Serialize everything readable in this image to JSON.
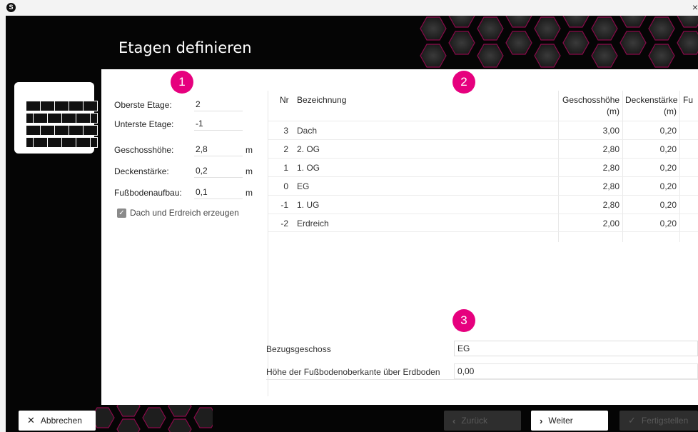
{
  "window": {
    "app_icon": "S",
    "close_glyph": "×"
  },
  "header": {
    "title": "Etagen definieren"
  },
  "markers": [
    "1",
    "2",
    "3"
  ],
  "form": {
    "oberste_label": "Oberste Etage:",
    "oberste_value": "2",
    "unterste_label": "Unterste Etage:",
    "unterste_value": "-1",
    "geschoss_label": "Geschosshöhe:",
    "geschoss_value": "2,8",
    "geschoss_unit": "m",
    "decken_label": "Deckenstärke:",
    "decken_value": "0,2",
    "decken_unit": "m",
    "fuss_label": "Fußbodenaufbau:",
    "fuss_value": "0,1",
    "fuss_unit": "m",
    "checkbox_label": "Dach und Erdreich erzeugen",
    "checkbox_checked": true
  },
  "table": {
    "headers": {
      "nr": "Nr",
      "bez": "Bezeichnung",
      "geschoss": "Geschosshöhe",
      "geschoss_unit": "(m)",
      "decken": "Deckenstärke",
      "decken_unit": "(m)",
      "fu": "Fu"
    },
    "rows": [
      {
        "nr": "3",
        "bez": "Dach",
        "geschoss": "3,00",
        "decken": "0,20"
      },
      {
        "nr": "2",
        "bez": "2. OG",
        "geschoss": "2,80",
        "decken": "0,20"
      },
      {
        "nr": "1",
        "bez": "1. OG",
        "geschoss": "2,80",
        "decken": "0,20"
      },
      {
        "nr": "0",
        "bez": "EG",
        "geschoss": "2,80",
        "decken": "0,20"
      },
      {
        "nr": "-1",
        "bez": "1. UG",
        "geschoss": "2,80",
        "decken": "0,20"
      },
      {
        "nr": "-2",
        "bez": "Erdreich",
        "geschoss": "2,00",
        "decken": "0,20"
      }
    ]
  },
  "reference": {
    "bezug_label": "Bezugsgeschoss",
    "bezug_value": "EG",
    "hoehe_label": "Höhe der Fußbodenoberkante über Erdboden",
    "hoehe_value": "0,00"
  },
  "footer": {
    "cancel_label": "Abbrechen",
    "back_label": "Zurück",
    "next_label": "Weiter",
    "finish_label": "Fertigstellen"
  },
  "colors": {
    "accent": "#e6007e",
    "dark": "#050505"
  }
}
